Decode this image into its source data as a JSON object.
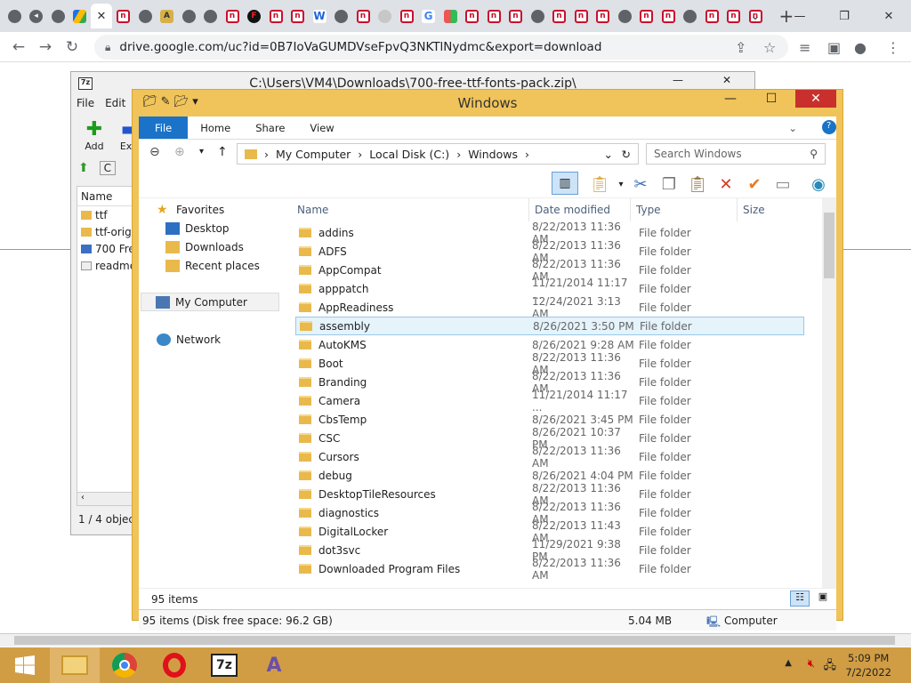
{
  "browser": {
    "url": "drive.google.com/uc?id=0B7IoVaGUMDVseFpvQ3NKTlNydmc&export=download",
    "new_tab": "+",
    "tabs": [
      {
        "icon": "globe-icon",
        "cls": "g",
        "glyph": ""
      },
      {
        "icon": "speaker-icon",
        "cls": "g",
        "glyph": "◂"
      },
      {
        "icon": "globe-icon",
        "cls": "g",
        "glyph": ""
      },
      {
        "icon": "google-drive-icon",
        "cls": "d",
        "glyph": ""
      },
      {
        "icon": "close-icon",
        "cls": "active",
        "glyph": "✕"
      },
      {
        "icon": "red-logo-icon",
        "cls": "r",
        "glyph": "n"
      },
      {
        "icon": "globe-icon",
        "cls": "g",
        "glyph": ""
      },
      {
        "icon": "font-icon",
        "cls": "y",
        "glyph": "A"
      },
      {
        "icon": "globe-icon",
        "cls": "g",
        "glyph": ""
      },
      {
        "icon": "globe-icon",
        "cls": "g",
        "glyph": ""
      },
      {
        "icon": "red-logo-icon",
        "cls": "r",
        "glyph": "n"
      },
      {
        "icon": "dark-logo-icon",
        "cls": "o",
        "glyph": "F"
      },
      {
        "icon": "red-logo-icon",
        "cls": "r",
        "glyph": "n"
      },
      {
        "icon": "red-logo-icon",
        "cls": "r",
        "glyph": "n"
      },
      {
        "icon": "w-logo-icon",
        "cls": "w",
        "glyph": "W"
      },
      {
        "icon": "globe-icon",
        "cls": "g",
        "glyph": ""
      },
      {
        "icon": "red-logo-icon",
        "cls": "r",
        "glyph": "n"
      },
      {
        "icon": "gray-icon",
        "cls": "gray",
        "glyph": ""
      },
      {
        "icon": "red-logo-icon",
        "cls": "r",
        "glyph": "n"
      },
      {
        "icon": "google-icon",
        "cls": "gg",
        "glyph": "G"
      },
      {
        "icon": "multicolor-icon",
        "cls": "m",
        "glyph": ""
      },
      {
        "icon": "red-logo-icon",
        "cls": "r",
        "glyph": "n"
      },
      {
        "icon": "red-logo-icon",
        "cls": "r",
        "glyph": "n"
      },
      {
        "icon": "red-logo-icon",
        "cls": "r",
        "glyph": "n"
      },
      {
        "icon": "globe-icon",
        "cls": "g",
        "glyph": ""
      },
      {
        "icon": "red-logo-icon",
        "cls": "r",
        "glyph": "n"
      },
      {
        "icon": "red-logo-icon",
        "cls": "r",
        "glyph": "n"
      },
      {
        "icon": "red-logo-icon",
        "cls": "r",
        "glyph": "n"
      },
      {
        "icon": "globe-icon",
        "cls": "g",
        "glyph": ""
      },
      {
        "icon": "red-logo-icon",
        "cls": "r",
        "glyph": "n"
      },
      {
        "icon": "red-logo-icon",
        "cls": "r",
        "glyph": "n"
      },
      {
        "icon": "globe-icon",
        "cls": "g",
        "glyph": ""
      },
      {
        "icon": "red-logo-icon",
        "cls": "r",
        "glyph": "n"
      },
      {
        "icon": "red-logo-icon",
        "cls": "r",
        "glyph": "n"
      },
      {
        "icon": "red-logo-icon",
        "cls": "r",
        "glyph": "n"
      }
    ]
  },
  "zip": {
    "title": "C:\\Users\\VM4\\Downloads\\700-free-ttf-fonts-pack.zip\\",
    "menu": [
      "File",
      "Edit"
    ],
    "tools": [
      "Add",
      "Extr"
    ],
    "col_name": "Name",
    "nav_label": "C",
    "items": [
      "ttf",
      "ttf-orig",
      "700 Fre",
      "readme"
    ],
    "status": "1 / 4 object"
  },
  "explorer": {
    "title": "Windows",
    "ribbon": [
      "File",
      "Home",
      "Share",
      "View"
    ],
    "breadcrumb": [
      "My Computer",
      "Local Disk (C:)",
      "Windows"
    ],
    "search_placeholder": "Search Windows",
    "nav": {
      "favorites": "Favorites",
      "desktop": "Desktop",
      "downloads": "Downloads",
      "recent": "Recent places",
      "computer": "My Computer",
      "network": "Network"
    },
    "columns": {
      "name": "Name",
      "date": "Date modified",
      "type": "Type",
      "size": "Size"
    },
    "files": [
      {
        "name": "addins",
        "date": "8/22/2013 11:36 AM",
        "type": "File folder"
      },
      {
        "name": "ADFS",
        "date": "8/22/2013 11:36 AM",
        "type": "File folder"
      },
      {
        "name": "AppCompat",
        "date": "8/22/2013 11:36 AM",
        "type": "File folder"
      },
      {
        "name": "apppatch",
        "date": "11/21/2014 11:17 ...",
        "type": "File folder"
      },
      {
        "name": "AppReadiness",
        "date": "12/24/2021 3:13 AM",
        "type": "File folder"
      },
      {
        "name": "assembly",
        "date": "8/26/2021 3:50 PM",
        "type": "File folder"
      },
      {
        "name": "AutoKMS",
        "date": "8/26/2021 9:28 AM",
        "type": "File folder"
      },
      {
        "name": "Boot",
        "date": "8/22/2013 11:36 AM",
        "type": "File folder"
      },
      {
        "name": "Branding",
        "date": "8/22/2013 11:36 AM",
        "type": "File folder"
      },
      {
        "name": "Camera",
        "date": "11/21/2014 11:17 ...",
        "type": "File folder"
      },
      {
        "name": "CbsTemp",
        "date": "8/26/2021 3:45 PM",
        "type": "File folder"
      },
      {
        "name": "CSC",
        "date": "8/26/2021 10:37 PM",
        "type": "File folder"
      },
      {
        "name": "Cursors",
        "date": "8/22/2013 11:36 AM",
        "type": "File folder"
      },
      {
        "name": "debug",
        "date": "8/26/2021 4:04 PM",
        "type": "File folder"
      },
      {
        "name": "DesktopTileResources",
        "date": "8/22/2013 11:36 AM",
        "type": "File folder"
      },
      {
        "name": "diagnostics",
        "date": "8/22/2013 11:36 AM",
        "type": "File folder"
      },
      {
        "name": "DigitalLocker",
        "date": "8/22/2013 11:43 AM",
        "type": "File folder"
      },
      {
        "name": "dot3svc",
        "date": "11/29/2021 9:38 PM",
        "type": "File folder"
      },
      {
        "name": "Downloaded Program Files",
        "date": "8/22/2013 11:36 AM",
        "type": "File folder"
      }
    ],
    "selected_index": 5,
    "item_count": "95 items",
    "status_left": "95 items (Disk free space: 96.2 GB)",
    "status_size": "5.04 MB",
    "status_loc": "Computer"
  },
  "taskbar": {
    "time": "5:09 PM",
    "date": "7/2/2022",
    "apps": [
      "start-icon",
      "file-explorer-icon",
      "chrome-icon",
      "opera-icon",
      "7zip-icon",
      "font-app-icon"
    ]
  },
  "colors": {
    "explorer_frame": "#f0c45a",
    "taskbar": "#d19d44",
    "accent": "#1a73c8"
  }
}
